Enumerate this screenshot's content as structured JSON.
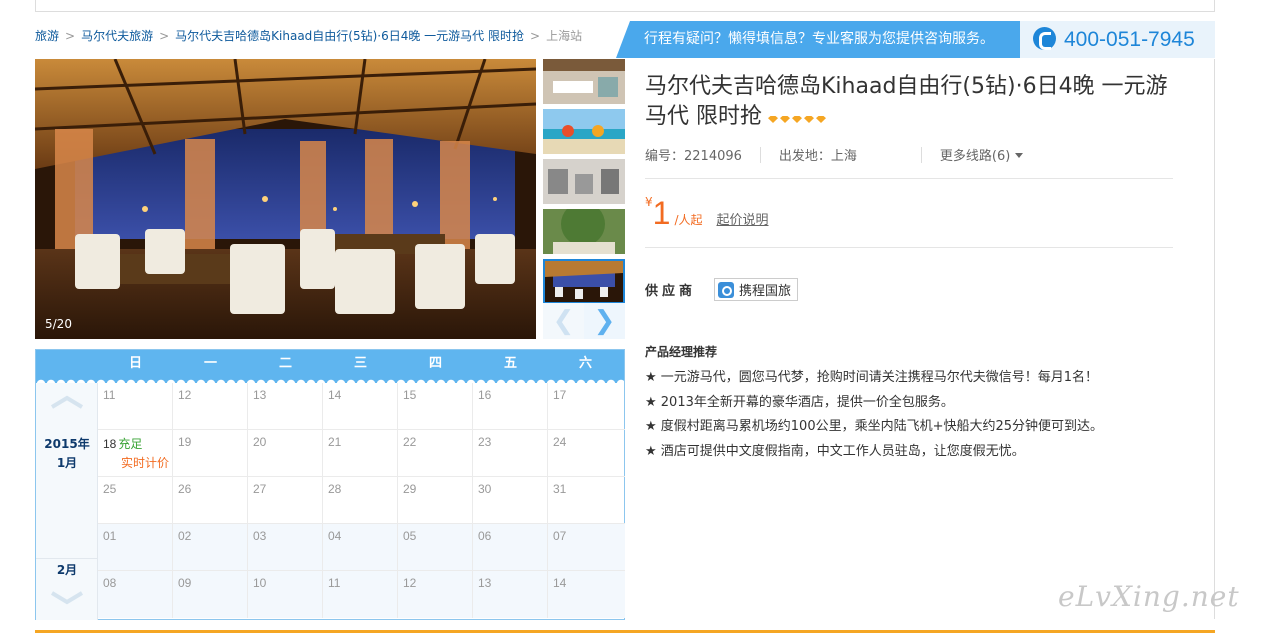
{
  "breadcrumb": {
    "items": [
      "旅游",
      "马尔代夫旅游",
      "马尔代夫吉哈德岛Kihaad自由行(5钻)·6日4晚 一元游马代 限时抢"
    ],
    "current": "上海站",
    "separator": ">"
  },
  "service": {
    "text": "行程有疑问？懒得填信息？专业客服为您提供咨询服务。",
    "phone": "400-051-7945",
    "icon": "phone-icon"
  },
  "gallery": {
    "counter": "5/20",
    "prev_icon": "chevron-left-icon",
    "next_icon": "chevron-right-icon",
    "prev_glyph": "❮",
    "next_glyph": "❯"
  },
  "product": {
    "title": "马尔代夫吉哈德岛Kihaad自由行(5钻)·6日4晚 一元游马代 限时抢",
    "diamond_count": 5,
    "code": "编号：2214096",
    "departure": "出发地：上海",
    "more_routes": "更多线路(6)",
    "price_symbol": "¥",
    "price": "1",
    "price_unit": "/人起",
    "price_explain": "起价说明",
    "supplier_label": "供应商",
    "supplier_name": "携程国旅"
  },
  "recommend": {
    "heading": "产品经理推荐",
    "items": [
      "★ 一元游马代，圆您马代梦，抢购时间请关注携程马尔代夫微信号！每月1名！",
      "★ 2013年全新开幕的豪华酒店，提供一价全包服务。",
      "★ 度假村距离马累机场约100公里，乘坐内陆飞机+快船大约25分钟便可到达。",
      "★ 酒店可提供中文度假指南，中文工作人员驻岛，让您度假无忧。"
    ]
  },
  "calendar": {
    "weekdays": [
      "日",
      "一",
      "二",
      "三",
      "四",
      "五",
      "六"
    ],
    "month1_year": "2015年",
    "month1": "1月",
    "month2": "2月",
    "rows": [
      [
        "11",
        "12",
        "13",
        "14",
        "15",
        "16",
        "17"
      ],
      [
        "18",
        "19",
        "20",
        "21",
        "22",
        "23",
        "24"
      ],
      [
        "25",
        "26",
        "27",
        "28",
        "29",
        "30",
        "31"
      ],
      [
        "01",
        "02",
        "03",
        "04",
        "05",
        "06",
        "07"
      ],
      [
        "08",
        "09",
        "10",
        "11",
        "12",
        "13",
        "14"
      ]
    ],
    "available_day": "18",
    "available_text": "充足",
    "realtime_text": "实时计价"
  },
  "watermark": "eLvXing.net",
  "colors": {
    "accent": "#1e86d8",
    "price": "#f26b21",
    "calendar_header": "#5fb5ef",
    "available": "#3aa336"
  }
}
